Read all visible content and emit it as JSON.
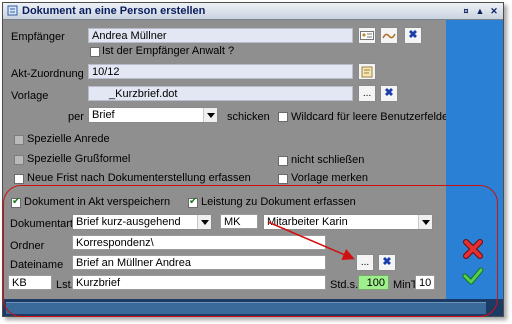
{
  "window": {
    "title": "Dokument an eine Person erstellen",
    "controls": {
      "pin": "¤",
      "minimize": "▲",
      "close": "✕"
    }
  },
  "form": {
    "empfaenger": {
      "label": "Empfänger",
      "value": "Andrea Müllner"
    },
    "anwalt": {
      "label": "Ist der Empfänger Anwalt ?",
      "checked": false
    },
    "akt": {
      "label": "Akt-Zuordnung",
      "value": "10/12"
    },
    "vorlage": {
      "label": "Vorlage",
      "value": "_Kurzbrief.dot",
      "browse": "..."
    },
    "per": {
      "label": "per",
      "value": "Brief",
      "suffix": "schicken"
    },
    "wildcard": {
      "label": "Wildcard für leere Benutzerfelder",
      "checked": false
    },
    "spezielle_anrede": {
      "label": "Spezielle Anrede",
      "checked": false
    },
    "spezielle_grussformel": {
      "label": "Spezielle Grußformel",
      "checked": false
    },
    "nicht_schliessen": {
      "label": "nicht schließen",
      "checked": false
    },
    "neue_frist": {
      "label": "Neue Frist nach Dokumenterstellung erfassen",
      "checked": false
    },
    "vorlage_merken": {
      "label": "Vorlage merken",
      "checked": false
    }
  },
  "section": {
    "akt_speichern": {
      "label": "Dokument in Akt verspeichern",
      "checked": true
    },
    "leistung": {
      "label": "Leistung zu Dokument erfassen",
      "checked": true
    },
    "dokumentart": {
      "label": "Dokumentart",
      "value": "Brief kurz-ausgehend"
    },
    "kuerzel": {
      "value": "MK"
    },
    "mitarbeiter": {
      "value": "Mitarbeiter Karin"
    },
    "ordner": {
      "label": "Ordner",
      "value": "Korrespondenz\\"
    },
    "dateiname": {
      "label": "Dateiname",
      "value": "Brief an Müllner Andrea",
      "browse": "..."
    },
    "kb": {
      "value": "KB"
    },
    "lst": {
      "label": "Lst.",
      "value": "Kurzbrief"
    },
    "stds": {
      "label": "Std.s.",
      "value": "100"
    },
    "mint": {
      "label": "MinT",
      "value": "10"
    }
  },
  "colors": {
    "window_bg": "#8f8f8f",
    "side_panel": "#2a80d4",
    "highlight": "#d01010",
    "field_bg": "#e3e6f3",
    "green_field": "#9df08c"
  },
  "icons": [
    "app-icon",
    "person-card-icon",
    "sign-icon",
    "close-x-icon",
    "note-icon",
    "cancel-icon",
    "ok-check-icon"
  ]
}
